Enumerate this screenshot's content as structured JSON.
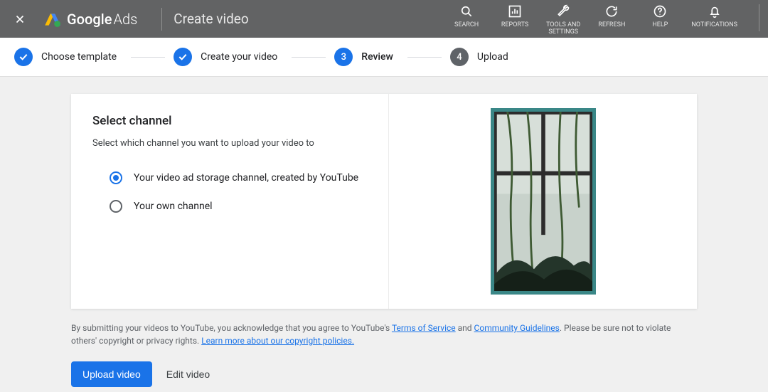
{
  "header": {
    "brand_main": "Google",
    "brand_sub": "Ads",
    "page_title": "Create video",
    "actions": {
      "search": "SEARCH",
      "reports": "REPORTS",
      "tools": "TOOLS AND\nSETTINGS",
      "refresh": "REFRESH",
      "help": "HELP",
      "notifications": "NOTIFICATIONS"
    }
  },
  "stepper": {
    "step1": "Choose template",
    "step2": "Create your video",
    "step3_num": "3",
    "step3": "Review",
    "step4_num": "4",
    "step4": "Upload"
  },
  "panel": {
    "title": "Select channel",
    "subtitle": "Select which channel you want to upload your video to",
    "option1": "Your video ad storage channel, created by YouTube",
    "option2": "Your own channel"
  },
  "disclaimer": {
    "prefix": "By submitting your videos to YouTube, you acknowledge that you agree to YouTube's ",
    "link_tos": "Terms of Service",
    "mid": " and ",
    "link_cg": "Community Guidelines",
    "suffix": ". Please be sure not to violate others' copyright or privacy rights. ",
    "link_learn": "Learn more about our copyright policies."
  },
  "buttons": {
    "upload": "Upload video",
    "edit": "Edit video"
  }
}
